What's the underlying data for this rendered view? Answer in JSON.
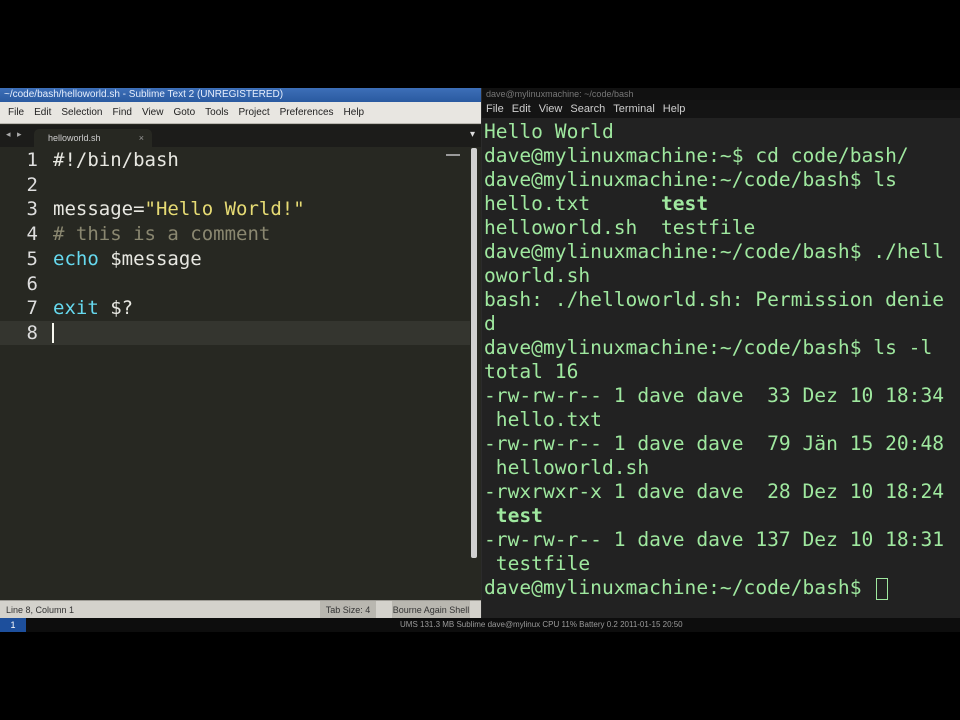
{
  "editor": {
    "title": "~/code/bash/helloworld.sh - Sublime Text 2 (UNREGISTERED)",
    "menu": [
      "File",
      "Edit",
      "Selection",
      "Find",
      "View",
      "Goto",
      "Tools",
      "Project",
      "Preferences",
      "Help"
    ],
    "tab_nav": "◂ ▸",
    "tab_label": "helloworld.sh",
    "tab_close": "×",
    "tab_dropdown": "▾",
    "status_left": "Line 8, Column 1",
    "status_mid": "Tab Size: 4",
    "status_right": "Bourne Again Shell",
    "lines": [
      {
        "n": "1",
        "parts": [
          {
            "t": "#!/bin/bash",
            "c": "plain"
          }
        ]
      },
      {
        "n": "2",
        "parts": []
      },
      {
        "n": "3",
        "parts": [
          {
            "t": "message=",
            "c": "plain"
          },
          {
            "t": "\"Hello World!\"",
            "c": "string"
          }
        ]
      },
      {
        "n": "4",
        "parts": [
          {
            "t": "# this is a comment",
            "c": "comment"
          }
        ]
      },
      {
        "n": "5",
        "parts": [
          {
            "t": "echo",
            "c": "keyword"
          },
          {
            "t": " $message",
            "c": "plain"
          }
        ]
      },
      {
        "n": "6",
        "parts": []
      },
      {
        "n": "7",
        "parts": [
          {
            "t": "exit",
            "c": "keyword"
          },
          {
            "t": " $?",
            "c": "plain"
          }
        ]
      },
      {
        "n": "8",
        "parts": [],
        "current": true
      }
    ]
  },
  "terminal": {
    "title": "dave@mylinuxmachine: ~/code/bash",
    "menu": [
      "File",
      "Edit",
      "View",
      "Search",
      "Terminal",
      "Help"
    ],
    "lines": [
      "Hello World",
      "dave@mylinuxmachine:~$ cd code/bash/",
      "dave@mylinuxmachine:~/code/bash$ ls",
      "hello.txt      test",
      "helloworld.sh  testfile",
      "dave@mylinuxmachine:~/code/bash$ ./hell",
      "oworld.sh",
      "bash: ./helloworld.sh: Permission denie",
      "d",
      "dave@mylinuxmachine:~/code/bash$ ls -l",
      "total 16",
      "-rw-rw-r-- 1 dave dave  33 Dez 10 18:34",
      " hello.txt",
      "-rw-rw-r-- 1 dave dave  79 Jän 15 20:48",
      " helloworld.sh",
      "-rwxrwxr-x 1 dave dave  28 Dez 10 18:24",
      " test",
      "-rw-rw-r-- 1 dave dave 137 Dez 10 18:31",
      " testfile",
      "dave@mylinuxmachine:~/code/bash$ "
    ]
  },
  "taskbar": {
    "start": "1",
    "tray": "UMS  131.3 MB  Sublime  dave@mylinux  CPU 11%  Battery 0.2  2011-01-15 20:50"
  }
}
